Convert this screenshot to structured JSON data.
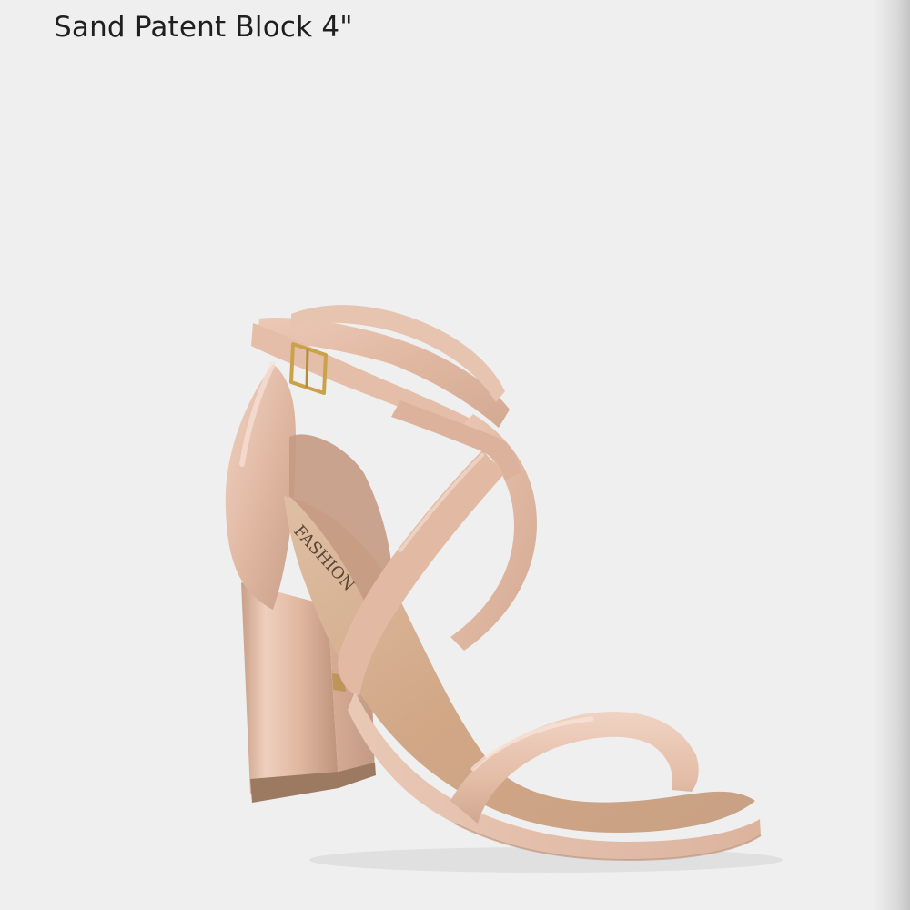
{
  "product": {
    "title": "Sand Patent Block 4\"",
    "insole_brand_text": "FASHION"
  },
  "icons": {
    "product_image": "sandal-photo"
  },
  "colors": {
    "background": "#efefef",
    "title_text": "#1f1f1f",
    "patent_leather": "#e2bca7",
    "insole": "#d2a888",
    "hardware": "#c9a24a"
  }
}
